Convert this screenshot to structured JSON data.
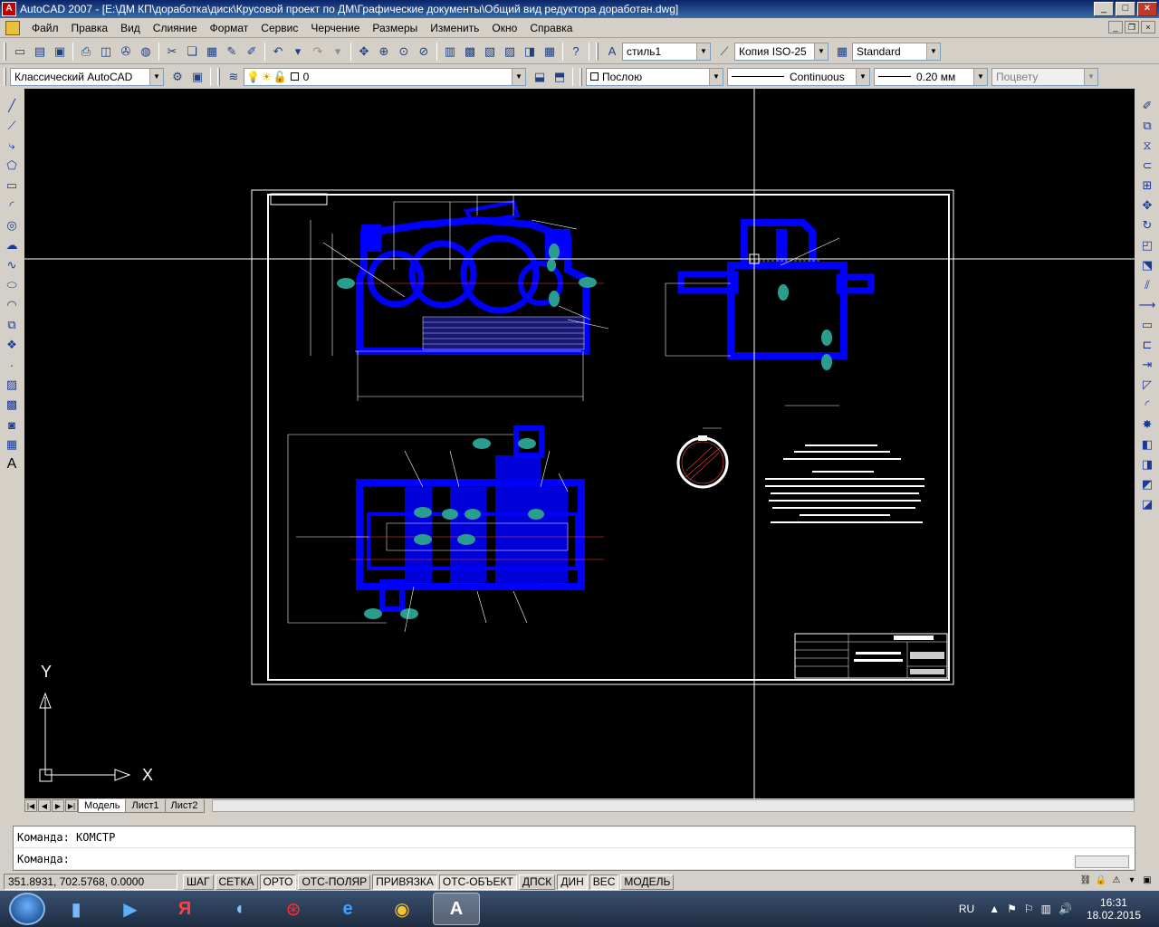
{
  "window": {
    "title": "AutoCAD 2007 - [E:\\ДМ КП\\доработка\\диск\\Крусовой проект по ДМ\\Графические документы\\Общий вид редуктора доработан.dwg]",
    "app_icon_glyph": "A"
  },
  "menu": {
    "items": [
      "Файл",
      "Правка",
      "Вид",
      "Слияние",
      "Формат",
      "Сервис",
      "Черчение",
      "Размеры",
      "Изменить",
      "Окно",
      "Справка"
    ]
  },
  "toolbar1": {
    "text_style": "стиль1",
    "dim_style": "Копия ISO-25",
    "table_style": "Standard"
  },
  "toolbar2": {
    "workspace": "Классический AutoCAD",
    "layer": "0",
    "color": "Послою",
    "linetype": "Continuous",
    "lineweight": "0.20 мм",
    "plotstyle": "Поцвету"
  },
  "layout_tabs": [
    "Модель",
    "Лист1",
    "Лист2"
  ],
  "command": {
    "history_line": "Команда:  КОМСТР",
    "prompt": "Команда:"
  },
  "status": {
    "coords": "351.8931, 702.5768, 0.0000",
    "toggles": [
      {
        "label": "ШАГ",
        "on": false
      },
      {
        "label": "СЕТКА",
        "on": false
      },
      {
        "label": "ОРТО",
        "on": true
      },
      {
        "label": "ОТС-ПОЛЯР",
        "on": false
      },
      {
        "label": "ПРИВЯЗКА",
        "on": true
      },
      {
        "label": "ОТС-ОБЪЕКТ",
        "on": true
      },
      {
        "label": "ДПСК",
        "on": false
      },
      {
        "label": "ДИН",
        "on": true
      },
      {
        "label": "ВЕС",
        "on": true
      },
      {
        "label": "МОДЕЛЬ",
        "on": false
      }
    ]
  },
  "ucs": {
    "x_label": "X",
    "y_label": "Y"
  },
  "taskbar": {
    "lang": "RU",
    "time": "16:31",
    "date": "18.02.2015"
  },
  "colors": {
    "canvas_bg": "#000000",
    "drawing_blue": "#0000ff",
    "drawing_teal": "#2a9d8f",
    "frame_white": "#ffffff"
  }
}
